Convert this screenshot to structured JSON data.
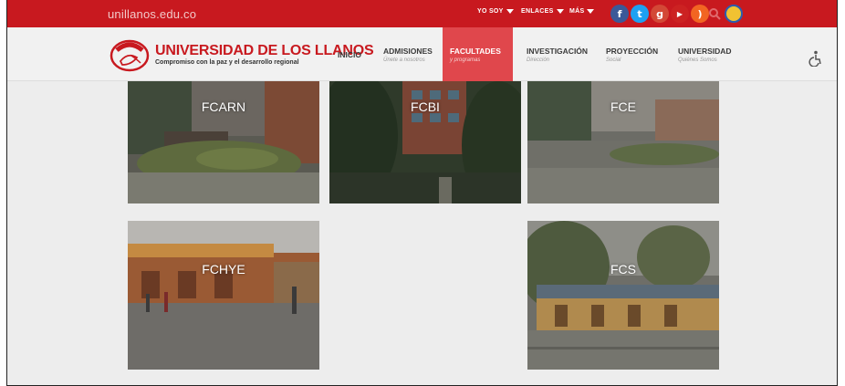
{
  "topbar": {
    "domain": "unillanos.edu.co",
    "menus": [
      {
        "label": "YO SOY"
      },
      {
        "label": "ENLACES"
      },
      {
        "label": "MÁS"
      }
    ],
    "social": [
      {
        "name": "facebook-icon",
        "glyph": "f",
        "color": "#3b5998"
      },
      {
        "name": "twitter-icon",
        "glyph": "t",
        "color": "#1da1f2"
      },
      {
        "name": "google-plus-icon",
        "glyph": "g",
        "color": "#d34836"
      },
      {
        "name": "youtube-icon",
        "glyph": "▶",
        "color": "#cc2222"
      },
      {
        "name": "rss-icon",
        "glyph": ")",
        "color": "#f26522"
      }
    ]
  },
  "header": {
    "logo_title": "UNIVERSIDAD DE LOS LLANOS",
    "logo_subtitle": "Compromiso con la paz y el desarrollo regional",
    "logo_badge": "UNILLANOS"
  },
  "nav": {
    "items": [
      {
        "title": "INICIO",
        "subtitle": ""
      },
      {
        "title": "ADMISIONES",
        "subtitle": "Únete a nosotros"
      },
      {
        "title": "FACULTADES",
        "subtitle": "y programas"
      },
      {
        "title": "INVESTIGACIÓN",
        "subtitle": "Dirección"
      },
      {
        "title": "PROYECCIÓN",
        "subtitle": "Social"
      },
      {
        "title": "UNIVERSIDAD",
        "subtitle": "Quiénes Somos"
      }
    ],
    "active": "FACULTADES"
  },
  "faculties": [
    {
      "label": "FCARN"
    },
    {
      "label": "FCBI"
    },
    {
      "label": "FCE"
    },
    {
      "label": "FCHYE"
    },
    {
      "label": "FCS"
    }
  ],
  "colors": {
    "brand_red": "#c8191f",
    "active_nav": "#e0474c",
    "background": "#ededed"
  }
}
